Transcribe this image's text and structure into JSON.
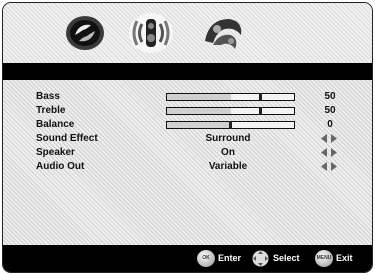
{
  "tabs": [
    {
      "name": "picture-tab",
      "icon": "picture-icon"
    },
    {
      "name": "audio-tab",
      "icon": "speaker-icon",
      "selected": true
    },
    {
      "name": "setup-tab",
      "icon": "setup-icon"
    }
  ],
  "menu": {
    "bass": {
      "label": "Bass",
      "value": "50",
      "level": 0.5
    },
    "treble": {
      "label": "Treble",
      "value": "50",
      "level": 0.5
    },
    "balance": {
      "label": "Balance",
      "value": "0",
      "level": 0.5
    },
    "sound_effect": {
      "label": "Sound Effect",
      "value": "Surround"
    },
    "speaker": {
      "label": "Speaker",
      "value": "On"
    },
    "audio_out": {
      "label": "Audio Out",
      "value": "Variable"
    }
  },
  "footer": {
    "enter": {
      "button": "OK",
      "label": "Enter"
    },
    "select": {
      "label": "Select"
    },
    "exit": {
      "button": "MENU",
      "label": "Exit"
    }
  }
}
